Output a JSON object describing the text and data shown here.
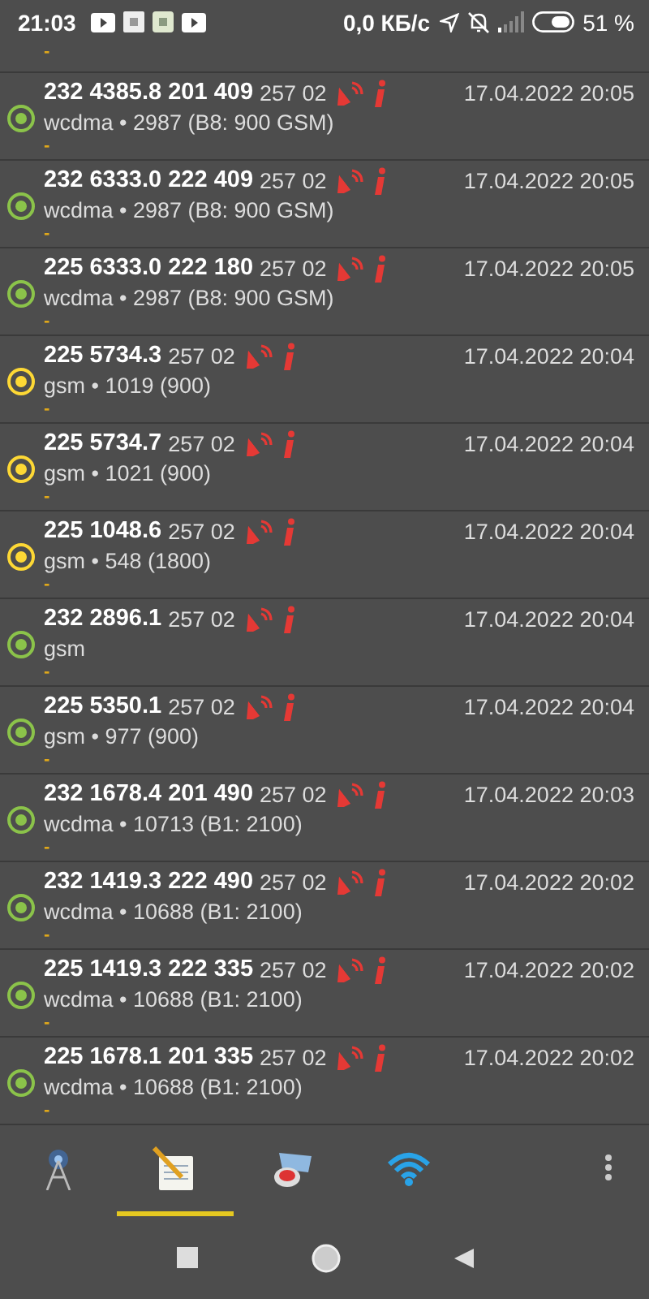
{
  "status_bar": {
    "time": "21:03",
    "speed": "0,0 КБ/с",
    "battery": "51 %"
  },
  "partial_row": {
    "note": "-"
  },
  "rows": [
    {
      "title": "232 4385.8 201 409",
      "code": "257 02",
      "date": "17.04.2022 20:05",
      "detail": "wcdma • 2987 (B8: 900 GSM)",
      "note": "-",
      "color": "#8bc34a"
    },
    {
      "title": "232 6333.0 222 409",
      "code": "257 02",
      "date": "17.04.2022 20:05",
      "detail": "wcdma • 2987 (B8: 900 GSM)",
      "note": "-",
      "color": "#8bc34a"
    },
    {
      "title": "225 6333.0 222 180",
      "code": "257 02",
      "date": "17.04.2022 20:05",
      "detail": "wcdma • 2987 (B8: 900 GSM)",
      "note": "-",
      "color": "#8bc34a"
    },
    {
      "title": "225 5734.3",
      "code": "257 02",
      "date": "17.04.2022 20:04",
      "detail": "gsm • 1019 (900)",
      "note": "-",
      "color": "#fdd835"
    },
    {
      "title": "225 5734.7",
      "code": "257 02",
      "date": "17.04.2022 20:04",
      "detail": "gsm • 1021 (900)",
      "note": "-",
      "color": "#fdd835"
    },
    {
      "title": "225 1048.6",
      "code": "257 02",
      "date": "17.04.2022 20:04",
      "detail": "gsm • 548 (1800)",
      "note": "-",
      "color": "#fdd835"
    },
    {
      "title": "232 2896.1",
      "code": "257 02",
      "date": "17.04.2022 20:04",
      "detail": "gsm",
      "note": "-",
      "color": "#8bc34a"
    },
    {
      "title": "225 5350.1",
      "code": "257 02",
      "date": "17.04.2022 20:04",
      "detail": "gsm • 977 (900)",
      "note": "-",
      "color": "#8bc34a"
    },
    {
      "title": "232 1678.4 201 490",
      "code": "257 02",
      "date": "17.04.2022 20:03",
      "detail": "wcdma • 10713 (B1: 2100)",
      "note": "-",
      "color": "#8bc34a"
    },
    {
      "title": "232 1419.3 222 490",
      "code": "257 02",
      "date": "17.04.2022 20:02",
      "detail": "wcdma • 10688 (B1: 2100)",
      "note": "-",
      "color": "#8bc34a"
    },
    {
      "title": "225 1419.3 222 335",
      "code": "257 02",
      "date": "17.04.2022 20:02",
      "detail": "wcdma • 10688 (B1: 2100)",
      "note": "-",
      "color": "#8bc34a"
    },
    {
      "title": "225 1678.1 201 335",
      "code": "257 02",
      "date": "17.04.2022 20:02",
      "detail": "wcdma • 10688 (B1: 2100)",
      "note": "-",
      "color": "#8bc34a"
    }
  ],
  "tabs": [
    {
      "kind": "tower",
      "selected": false
    },
    {
      "kind": "notepad",
      "selected": true
    },
    {
      "kind": "compass",
      "selected": false
    },
    {
      "kind": "wifi",
      "selected": false
    }
  ]
}
